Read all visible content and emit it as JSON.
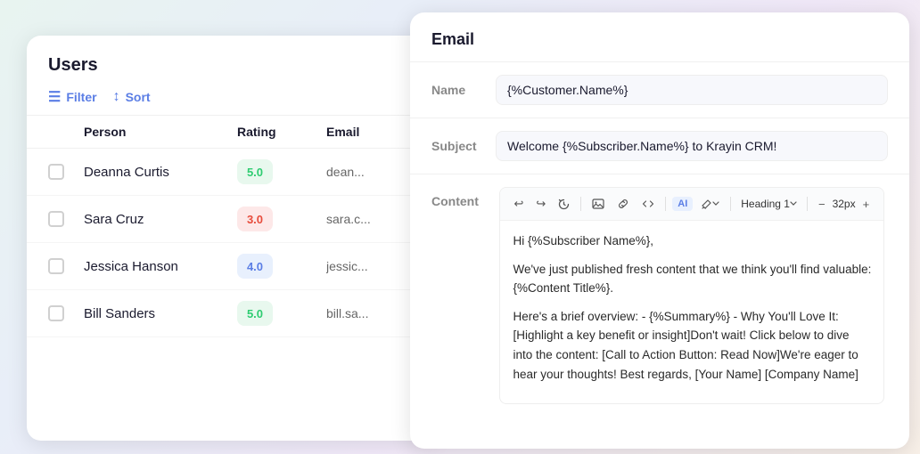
{
  "users_panel": {
    "title": "Users",
    "toolbar": {
      "filter_label": "Filter",
      "sort_label": "Sort"
    },
    "table": {
      "headers": [
        "",
        "Person",
        "Rating",
        "Email"
      ],
      "rows": [
        {
          "name": "Deanna Curtis",
          "rating": "5.0",
          "rating_type": "green",
          "email": "dean..."
        },
        {
          "name": "Sara Cruz",
          "rating": "3.0",
          "rating_type": "red",
          "email": "sara.c..."
        },
        {
          "name": "Jessica Hanson",
          "rating": "4.0",
          "rating_type": "blue",
          "email": "jessic..."
        },
        {
          "name": "Bill Sanders",
          "rating": "5.0",
          "rating_type": "green",
          "email": "bill.sa..."
        }
      ]
    }
  },
  "email_panel": {
    "title": "Email",
    "fields": {
      "name_label": "Name",
      "name_value": "{%Customer.Name%}",
      "subject_label": "Subject",
      "subject_value": "Welcome {%Subscriber.Name%} to Krayin CRM!",
      "content_label": "Content"
    },
    "editor": {
      "toolbar": {
        "undo": "↩",
        "redo": "↪",
        "history": "🕐",
        "image": "🖼",
        "link": "🔗",
        "code": "</>",
        "ai": "AI",
        "brush": "🖌",
        "heading": "Heading 1",
        "font_size": "32px",
        "minus": "−",
        "plus": "+"
      },
      "content_lines": [
        "Hi {%Subscriber Name%},",
        "",
        "We've just published fresh content that we think you'll find valuable: {%Content Title%}.",
        "",
        "Here's a brief overview: - {%Summary%} - Why You'll Love It: [Highlight a key benefit or insight]Don't wait! Click below to dive into the content: [Call to Action Button: Read Now]We're eager to hear your thoughts! Best regards, [Your Name] [Company Name]"
      ]
    }
  }
}
